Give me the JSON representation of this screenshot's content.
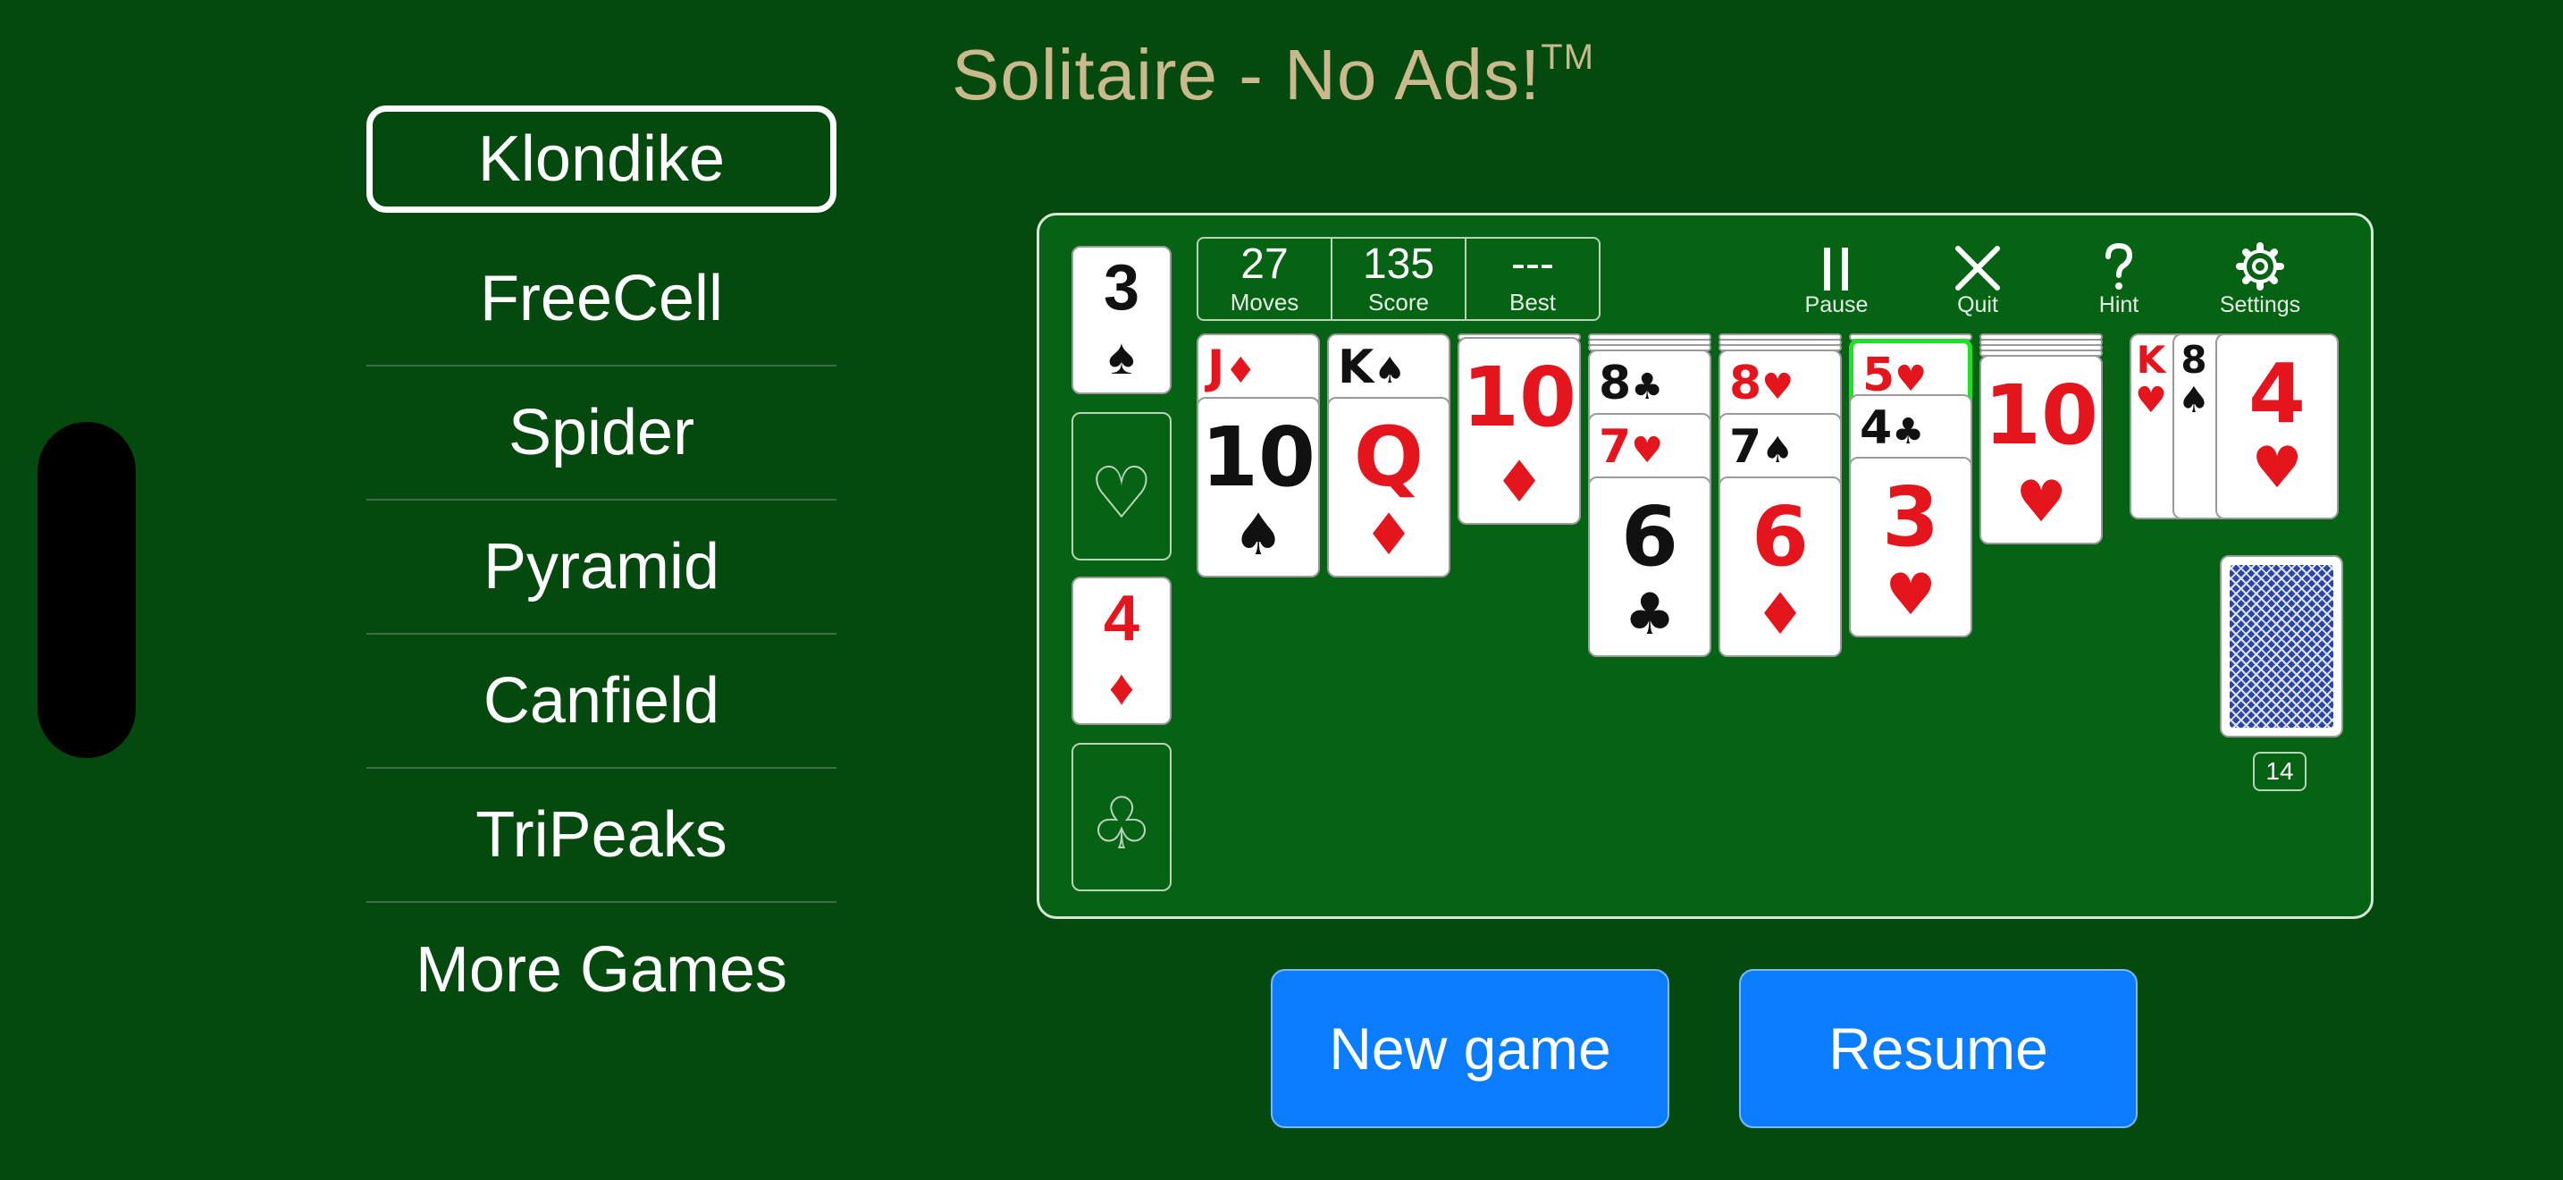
{
  "title": {
    "text": "Solitaire - No Ads!",
    "mark": "TM"
  },
  "menu": {
    "items": [
      {
        "label": "Klondike",
        "selected": true
      },
      {
        "label": "FreeCell"
      },
      {
        "label": "Spider"
      },
      {
        "label": "Pyramid"
      },
      {
        "label": "Canfield"
      },
      {
        "label": "TriPeaks"
      },
      {
        "label": "More Games"
      }
    ]
  },
  "stats": {
    "moves_value": "27",
    "moves_label": "Moves",
    "score_value": "135",
    "score_label": "Score",
    "best_value": "---",
    "best_label": "Best"
  },
  "toolbar": {
    "pause_label": "Pause",
    "quit_label": "Quit",
    "hint_label": "Hint",
    "settings_label": "Settings"
  },
  "foundations": [
    {
      "rank": "3",
      "suit": "♠",
      "color": "black"
    },
    {
      "empty_suit": "♡"
    },
    {
      "rank": "4",
      "suit": "♦",
      "color": "red"
    },
    {
      "empty_suit": "♧"
    }
  ],
  "tableau": {
    "col1": [
      {
        "rank": "J",
        "suit": "♦"
      },
      {
        "rank": "10",
        "suit": "♠"
      }
    ],
    "col2": [
      {
        "rank": "K",
        "suit": "♠"
      },
      {
        "rank": "Q",
        "suit": "♦"
      }
    ],
    "col3": [
      {
        "rank": "10",
        "suit": "♦"
      }
    ],
    "col4": [
      {
        "rank": "8",
        "suit": "♣"
      },
      {
        "rank": "7",
        "suit": "♥"
      },
      {
        "rank": "6",
        "suit": "♣"
      }
    ],
    "col5": [
      {
        "rank": "8",
        "suit": "♥"
      },
      {
        "rank": "7",
        "suit": "♠"
      },
      {
        "rank": "6",
        "suit": "♦"
      }
    ],
    "col6": [
      {
        "rank": "5",
        "suit": "♥"
      },
      {
        "rank": "4",
        "suit": "♣"
      },
      {
        "rank": "3",
        "suit": "♥"
      }
    ],
    "col7": [
      {
        "rank": "10",
        "suit": "♥"
      }
    ]
  },
  "waste": [
    {
      "rank": "K",
      "suit": "♥"
    },
    {
      "rank": "8",
      "suit": "♠"
    },
    {
      "rank": "4",
      "suit": "♥"
    }
  ],
  "stock": {
    "count": "14"
  },
  "buttons": {
    "new_game": "New game",
    "resume": "Resume"
  },
  "colors": {
    "background": "#044a0e",
    "board": "#066314",
    "button": "#0a7dff",
    "red_suit": "#e5151e",
    "highlight": "#21e028"
  }
}
